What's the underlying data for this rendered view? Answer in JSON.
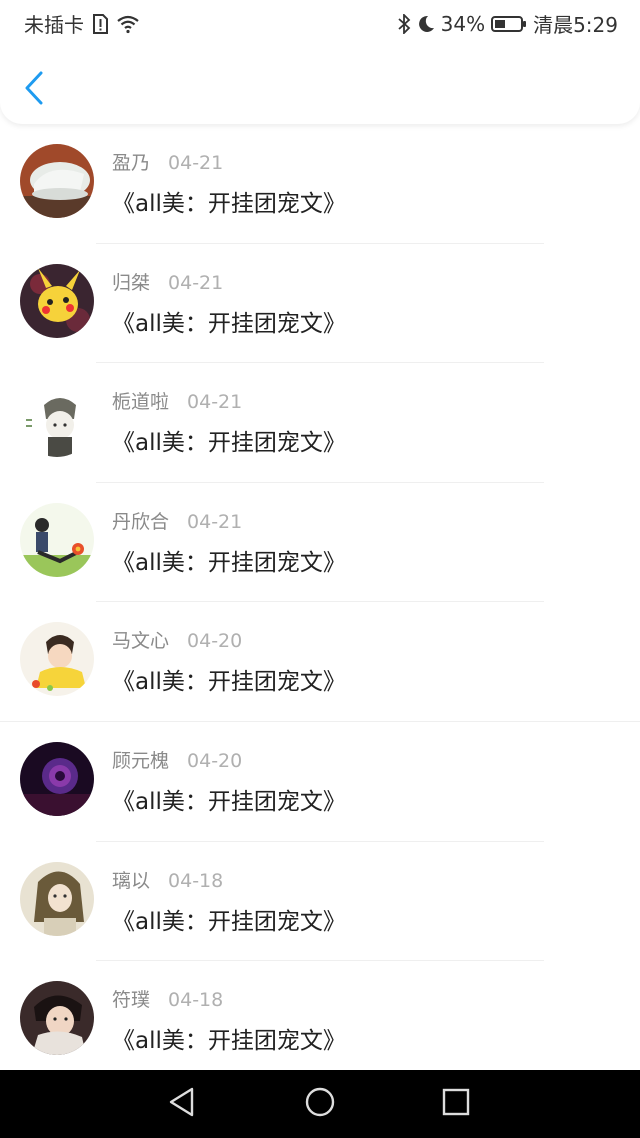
{
  "status_bar": {
    "carrier": "未插卡",
    "battery_percent": "34%",
    "time": "清晨5:29"
  },
  "icons": {
    "back": "chevron-left-icon",
    "sim_alert": "sim-alert-icon",
    "wifi": "wifi-icon",
    "bluetooth": "bluetooth-icon",
    "moon": "moon-icon",
    "battery": "battery-icon",
    "nav_back": "triangle-back-icon",
    "nav_home": "circle-home-icon",
    "nav_recents": "square-recents-icon"
  },
  "colors": {
    "accent": "#1e9bf0",
    "name_text": "#8a8a8a",
    "date_text": "#b0b0b0",
    "title_text": "#222222"
  },
  "list": [
    {
      "name": "盈乃",
      "date": "04-21",
      "title": "《all美：开挂团宠文》"
    },
    {
      "name": "归桀",
      "date": "04-21",
      "title": "《all美：开挂团宠文》"
    },
    {
      "name": "栀道啦",
      "date": "04-21",
      "title": "《all美：开挂团宠文》"
    },
    {
      "name": "丹欣合",
      "date": "04-21",
      "title": "《all美：开挂团宠文》"
    },
    {
      "name": "马文心",
      "date": "04-20",
      "title": "《all美：开挂团宠文》"
    },
    {
      "name": "顾元槐",
      "date": "04-20",
      "title": "《all美：开挂团宠文》"
    },
    {
      "name": "璃以",
      "date": "04-18",
      "title": "《all美：开挂团宠文》"
    },
    {
      "name": "符璞",
      "date": "04-18",
      "title": "《all美：开挂团宠文》"
    }
  ]
}
